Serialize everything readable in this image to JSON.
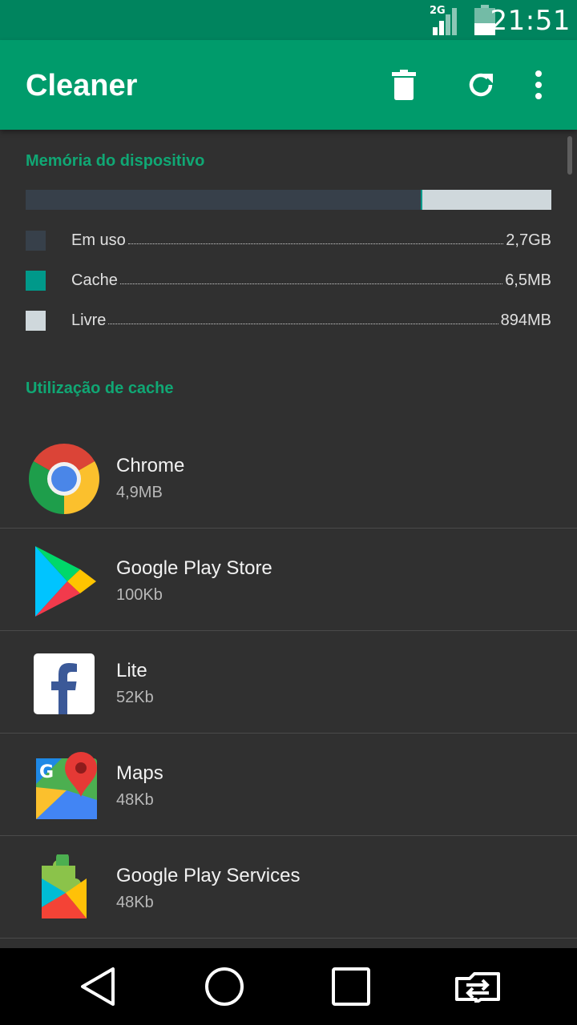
{
  "status_bar": {
    "network_type": "2G",
    "signal_level": 0.6,
    "battery_level": 0.45,
    "time": "21:51"
  },
  "app_bar": {
    "title": "Cleaner",
    "actions": [
      "delete-icon",
      "refresh-icon",
      "more-vertical-icon"
    ]
  },
  "memory": {
    "header": "Memória do dispositivo",
    "usage_fractions": {
      "used": 0.752,
      "cache": 0.003,
      "free": 0.245
    },
    "legend": [
      {
        "label": "Em uso",
        "value": "2,7GB",
        "color": "#37404a"
      },
      {
        "label": "Cache",
        "value": "6,5MB",
        "color": "#00998a"
      },
      {
        "label": "Livre",
        "value": "894MB",
        "color": "#cfd8dc"
      }
    ]
  },
  "cache": {
    "header": "Utilização de cache",
    "apps": [
      {
        "name": "Chrome",
        "size": "4,9MB",
        "icon": "chrome-icon"
      },
      {
        "name": "Google Play Store",
        "size": "100Kb",
        "icon": "play-store-icon"
      },
      {
        "name": "Lite",
        "size": "52Kb",
        "icon": "facebook-lite-icon"
      },
      {
        "name": "Maps",
        "size": "48Kb",
        "icon": "maps-icon"
      },
      {
        "name": "Google Play Services",
        "size": "48Kb",
        "icon": "play-services-icon"
      }
    ]
  },
  "nav_bar": {
    "buttons": [
      "back-icon",
      "home-icon",
      "recents-icon",
      "switch-app-icon"
    ]
  },
  "colors": {
    "status_bar": "#00845e",
    "app_bar": "#009b6b",
    "accent": "#10a774",
    "background": "#303030"
  }
}
